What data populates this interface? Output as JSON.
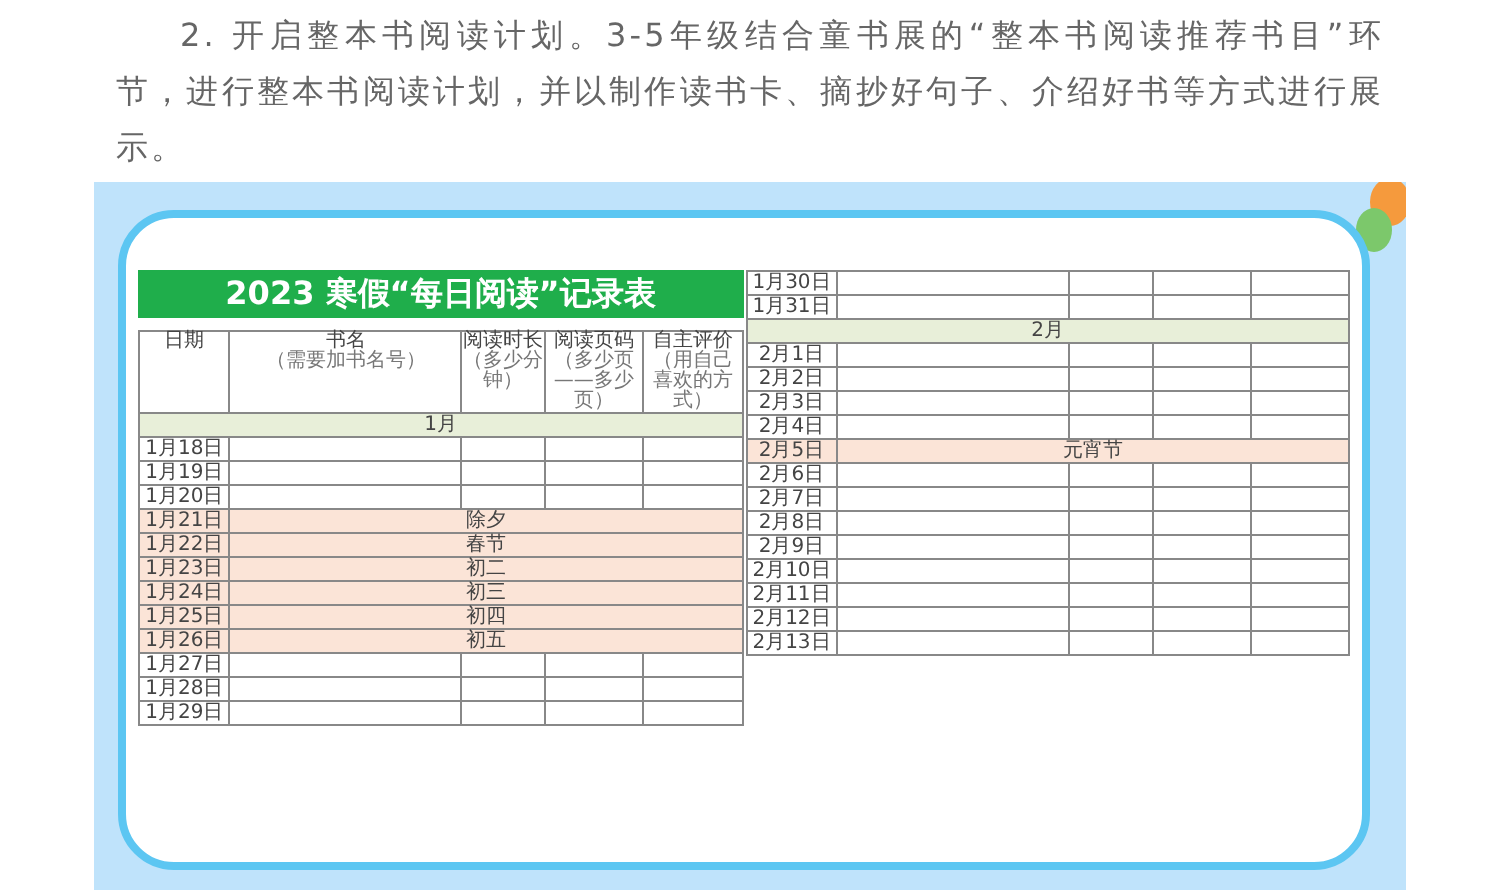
{
  "paragraph": "2. 开启整本书阅读计划。3-5年级结合童书展的“整本书阅读推荐书目”环节，进行整本书阅读计划，并以制作读书卡、摘抄好句子、介绍好书等方式进行展示。",
  "sheet": {
    "title": "2023 寒假“每日阅读”记录表",
    "columns": [
      {
        "label": "日期"
      },
      {
        "label": "书名",
        "note": "（需要加书名号）"
      },
      {
        "label": "阅读时长",
        "note": "（多少分钟）"
      },
      {
        "label": "阅读页码",
        "note": "（多少页——多少页）"
      },
      {
        "label": "自主评价",
        "note": "（用自己喜欢的方式）"
      }
    ],
    "left_rows": [
      {
        "kind": "month",
        "label": "1月"
      },
      {
        "kind": "blank",
        "date": "1月18日"
      },
      {
        "kind": "blank",
        "date": "1月19日"
      },
      {
        "kind": "blank",
        "date": "1月20日"
      },
      {
        "kind": "holiday",
        "date": "1月21日",
        "label": "除夕"
      },
      {
        "kind": "holiday",
        "date": "1月22日",
        "label": "春节"
      },
      {
        "kind": "holiday",
        "date": "1月23日",
        "label": "初二"
      },
      {
        "kind": "holiday",
        "date": "1月24日",
        "label": "初三"
      },
      {
        "kind": "holiday",
        "date": "1月25日",
        "label": "初四"
      },
      {
        "kind": "holiday",
        "date": "1月26日",
        "label": "初五"
      },
      {
        "kind": "blank",
        "date": "1月27日"
      },
      {
        "kind": "blank",
        "date": "1月28日"
      },
      {
        "kind": "blank",
        "date": "1月29日"
      }
    ],
    "right_rows": [
      {
        "kind": "blank",
        "date": "1月30日"
      },
      {
        "kind": "blank",
        "date": "1月31日"
      },
      {
        "kind": "month",
        "label": "2月"
      },
      {
        "kind": "blank",
        "date": "2月1日"
      },
      {
        "kind": "blank",
        "date": "2月2日"
      },
      {
        "kind": "blank",
        "date": "2月3日"
      },
      {
        "kind": "blank",
        "date": "2月4日"
      },
      {
        "kind": "holiday",
        "date": "2月5日",
        "label": "元宵节"
      },
      {
        "kind": "blank",
        "date": "2月6日"
      },
      {
        "kind": "blank",
        "date": "2月7日"
      },
      {
        "kind": "blank",
        "date": "2月8日"
      },
      {
        "kind": "blank",
        "date": "2月9日"
      },
      {
        "kind": "blank",
        "date": "2月10日"
      },
      {
        "kind": "blank",
        "date": "2月11日"
      },
      {
        "kind": "blank",
        "date": "2月12日"
      },
      {
        "kind": "blank",
        "date": "2月13日"
      }
    ]
  }
}
